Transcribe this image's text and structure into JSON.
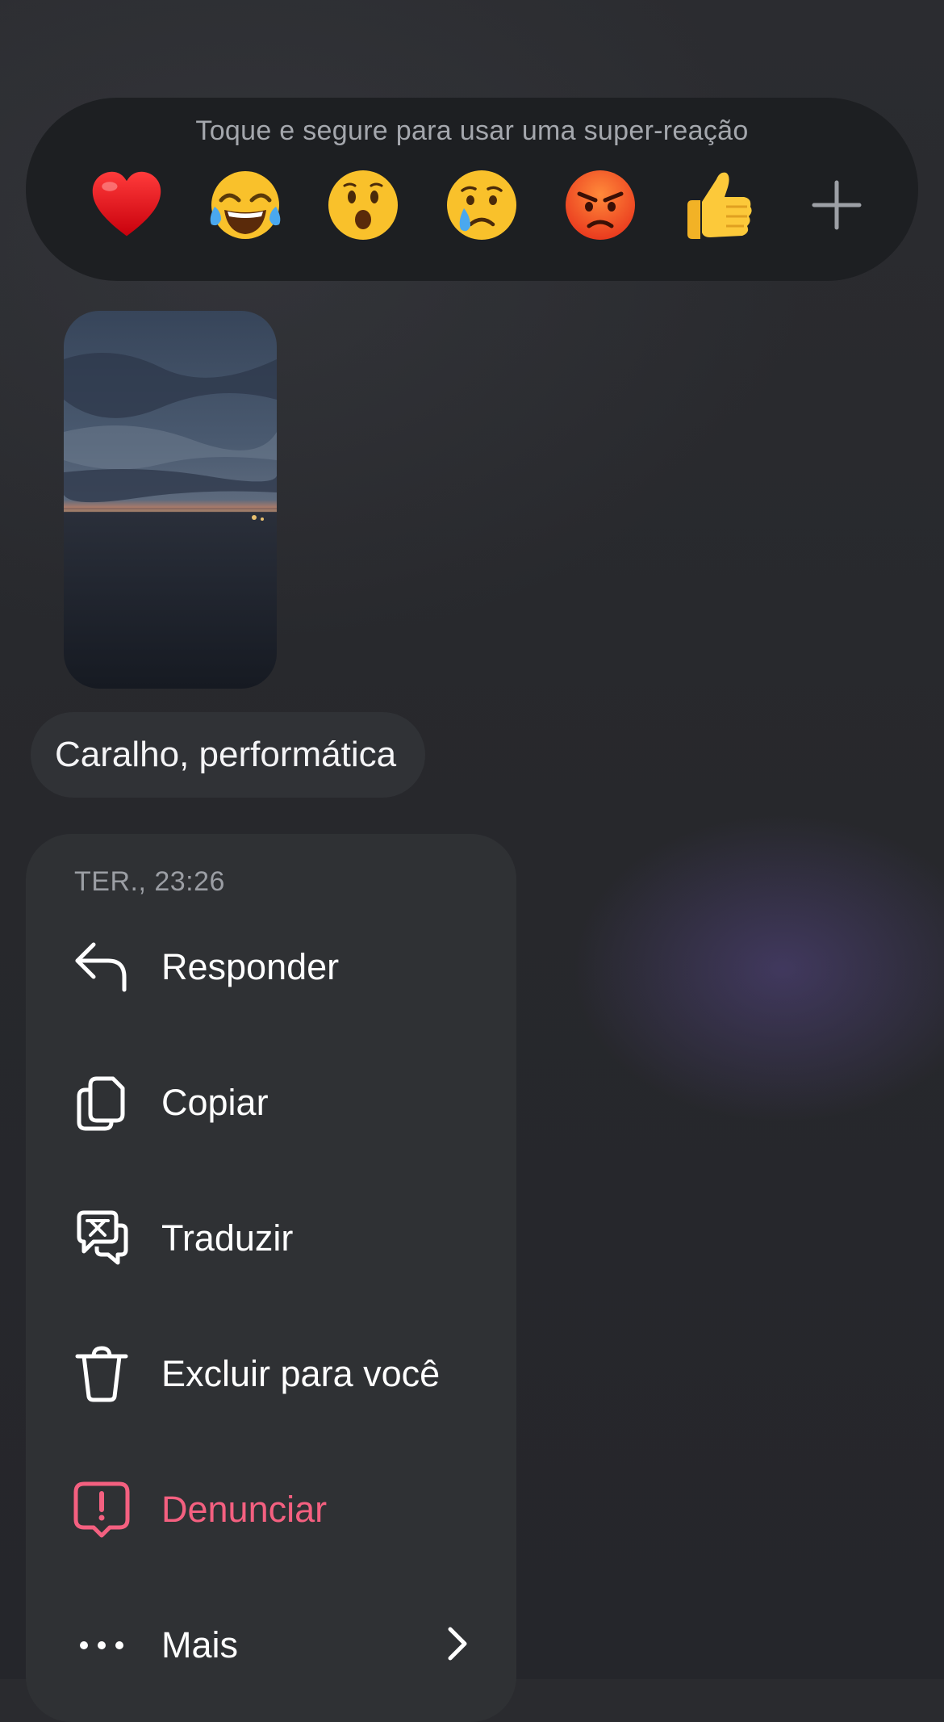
{
  "reaction_bar": {
    "hint": "Toque e segure para usar uma super-reação",
    "reactions": [
      {
        "name": "red-heart",
        "glyph": "❤️"
      },
      {
        "name": "face-with-tears-of-joy",
        "glyph": "😂"
      },
      {
        "name": "face-with-open-mouth",
        "glyph": "😮"
      },
      {
        "name": "crying-face",
        "glyph": "😢"
      },
      {
        "name": "pouting-face",
        "glyph": "😡"
      },
      {
        "name": "thumbs-up",
        "glyph": "👍"
      }
    ],
    "more_icon": "plus-icon"
  },
  "message": {
    "text": "Caralho, performática"
  },
  "menu": {
    "timestamp": "TER., 23:26",
    "items": [
      {
        "label": "Responder",
        "icon": "reply-icon"
      },
      {
        "label": "Copiar",
        "icon": "copy-icon"
      },
      {
        "label": "Traduzir",
        "icon": "translate-icon"
      },
      {
        "label": "Excluir para você",
        "icon": "trash-icon"
      },
      {
        "label": "Denunciar",
        "icon": "report-icon",
        "color": "#f46080"
      },
      {
        "label": "Mais",
        "icon": "more-dots-icon"
      }
    ]
  },
  "colors": {
    "background": "#2a2b2f",
    "reaction_bar": "#1d1f22",
    "menu": "#2f3134",
    "danger": "#f46080"
  }
}
